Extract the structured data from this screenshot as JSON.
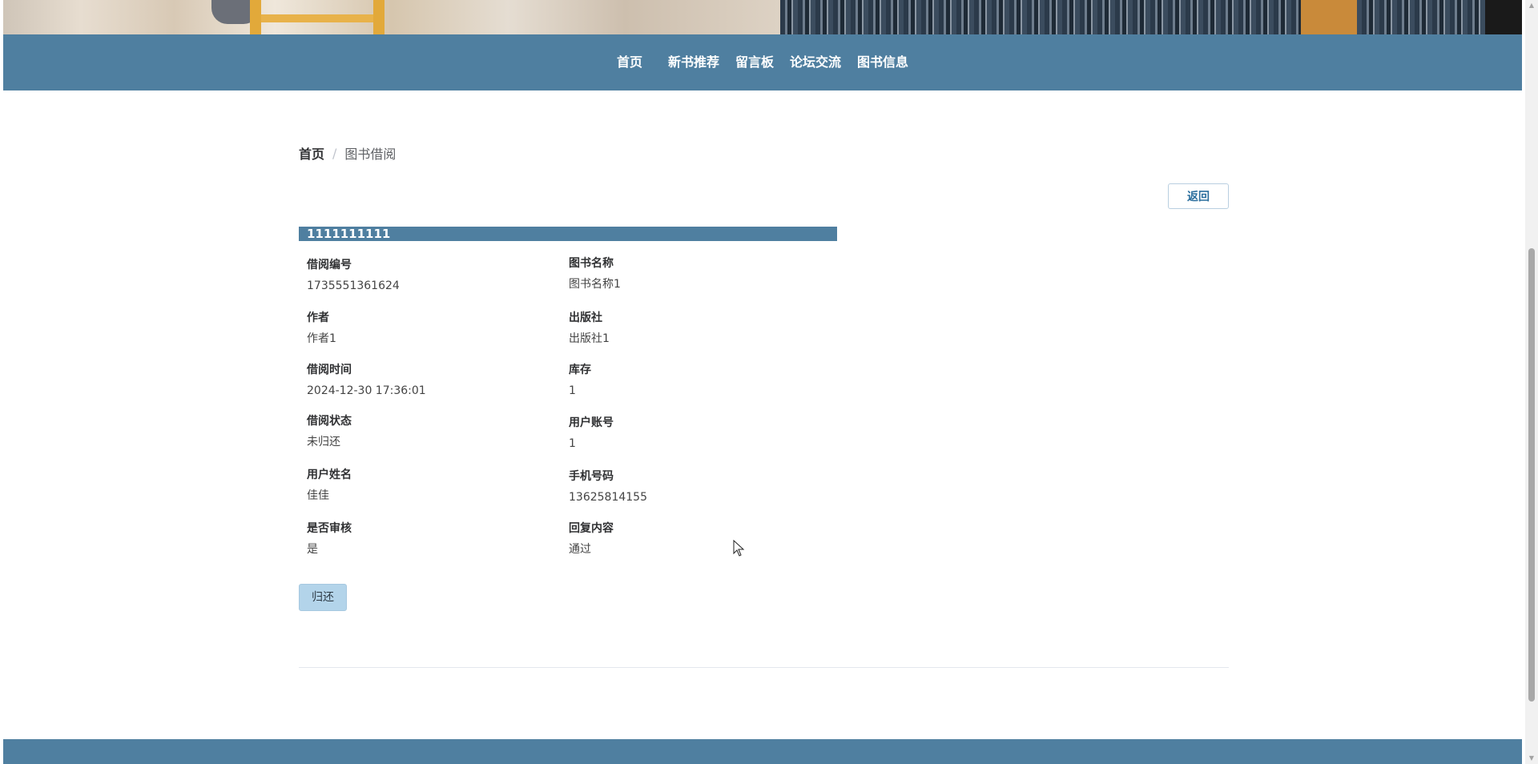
{
  "nav": {
    "items": [
      "首页",
      "新书推荐",
      "留言板",
      "论坛交流",
      "图书信息"
    ]
  },
  "breadcrumb": {
    "home": "首页",
    "separator": "/",
    "current": "图书借阅"
  },
  "back_button": "返回",
  "detail": {
    "title": "1111111111",
    "fields": [
      {
        "label": "借阅编号",
        "value": "1735551361624"
      },
      {
        "label": "图书名称",
        "value": "图书名称1"
      },
      {
        "label": "作者",
        "value": "作者1"
      },
      {
        "label": "出版社",
        "value": "出版社1"
      },
      {
        "label": "借阅时间",
        "value": "2024-12-30 17:36:01"
      },
      {
        "label": "库存",
        "value": "1"
      },
      {
        "label": "借阅状态",
        "value": "未归还"
      },
      {
        "label": "用户账号",
        "value": "1"
      },
      {
        "label": "用户姓名",
        "value": "佳佳"
      },
      {
        "label": "手机号码",
        "value": "13625814155"
      },
      {
        "label": "是否审核",
        "value": "是"
      },
      {
        "label": "回复内容",
        "value": "通过"
      }
    ]
  },
  "return_button": "归还",
  "colors": {
    "primary": "#4f7fa0",
    "return_button_bg": "#b3d4ea"
  }
}
